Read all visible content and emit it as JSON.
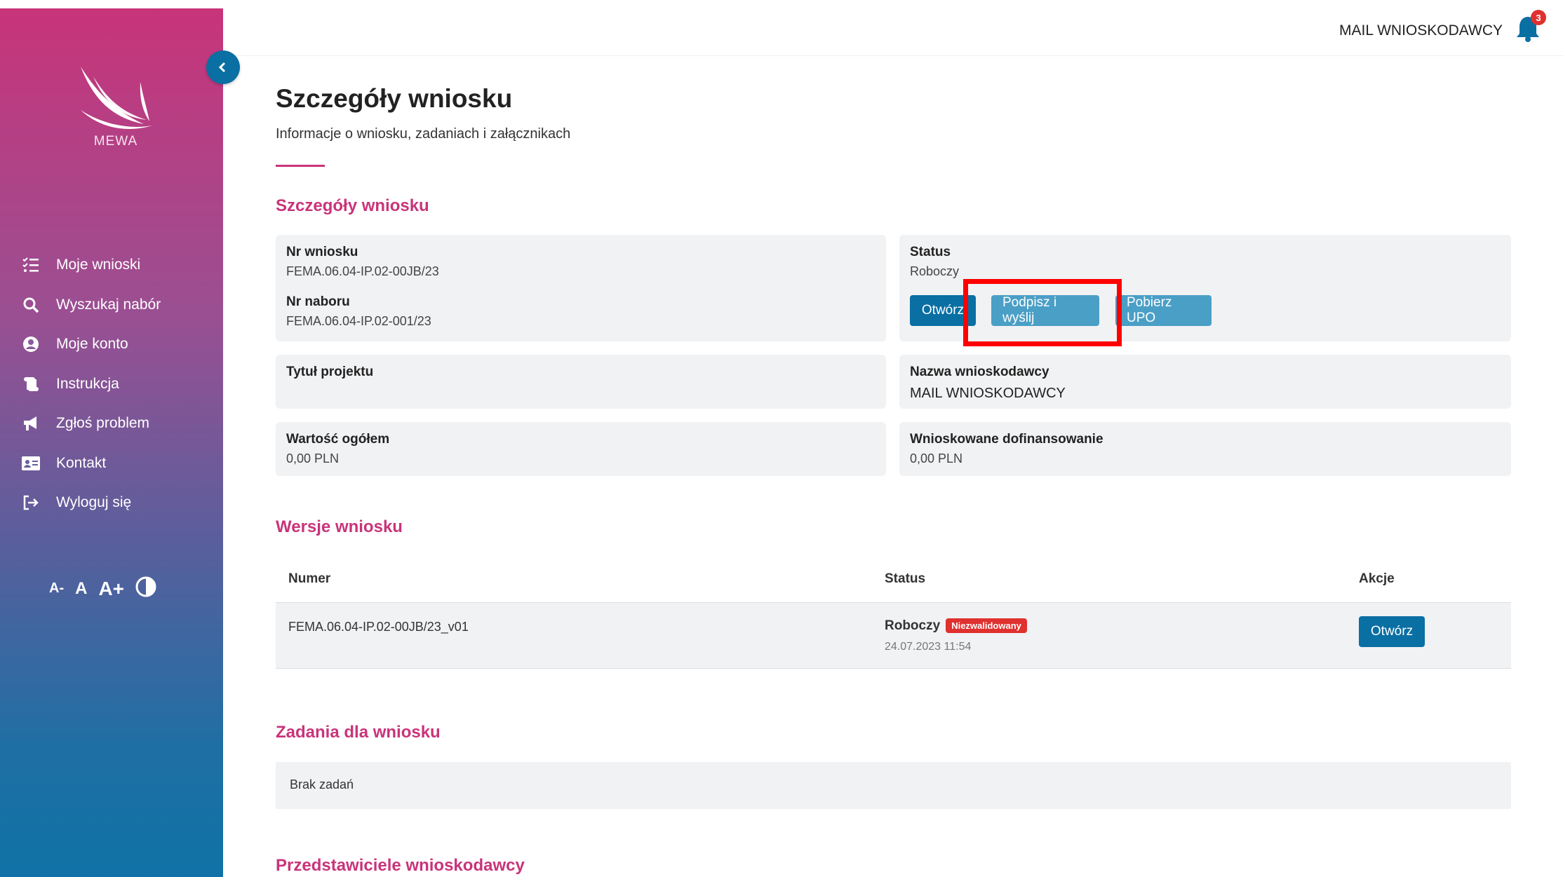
{
  "sidebar": {
    "logo_text": "MEWA",
    "items": [
      {
        "label": "Moje wnioski",
        "icon": "list-check-icon"
      },
      {
        "label": "Wyszukaj nabór",
        "icon": "search-icon"
      },
      {
        "label": "Moje konto",
        "icon": "user-circle-icon"
      },
      {
        "label": "Instrukcja",
        "icon": "scroll-icon"
      },
      {
        "label": "Zgłoś problem",
        "icon": "megaphone-icon"
      },
      {
        "label": "Kontakt",
        "icon": "contact-card-icon"
      },
      {
        "label": "Wyloguj się",
        "icon": "logout-icon"
      }
    ],
    "font_tools": {
      "smaller": "A-",
      "normal": "A",
      "bigger": "A+"
    }
  },
  "header": {
    "user": "MAIL WNIOSKODAWCY",
    "notifications": "3"
  },
  "page": {
    "title": "Szczegóły wniosku",
    "subtitle": "Informacje o wniosku, zadaniach i załącznikach"
  },
  "details": {
    "section_title": "Szczegóły wniosku",
    "nr_wniosku_label": "Nr wniosku",
    "nr_wniosku": "FEMA.06.04-IP.02-00JB/23",
    "nr_naboru_label": "Nr naboru",
    "nr_naboru": "FEMA.06.04-IP.02-001/23",
    "status_label": "Status",
    "status": "Roboczy",
    "btn_open": "Otwórz",
    "btn_sign": "Podpisz i wyślij",
    "btn_upo": "Pobierz UPO",
    "tytul_label": "Tytuł projektu",
    "tytul": "",
    "nazwa_label": "Nazwa wnioskodawcy",
    "nazwa": "MAIL WNIOSKODAWCY",
    "wartosc_label": "Wartość ogółem",
    "wartosc": "0,00 PLN",
    "dofin_label": "Wnioskowane dofinansowanie",
    "dofin": "0,00 PLN"
  },
  "versions": {
    "section_title": "Wersje wniosku",
    "headers": {
      "numer": "Numer",
      "status": "Status",
      "akcje": "Akcje"
    },
    "rows": [
      {
        "numer": "FEMA.06.04-IP.02-00JB/23_v01",
        "status": "Roboczy",
        "badge": "Niezwalidowany",
        "date": "24.07.2023 11:54",
        "action": "Otwórz"
      }
    ]
  },
  "tasks": {
    "section_title": "Zadania dla wniosku",
    "empty": "Brak zadań"
  },
  "representatives": {
    "section_title": "Przedstawiciele wnioskodawcy"
  }
}
